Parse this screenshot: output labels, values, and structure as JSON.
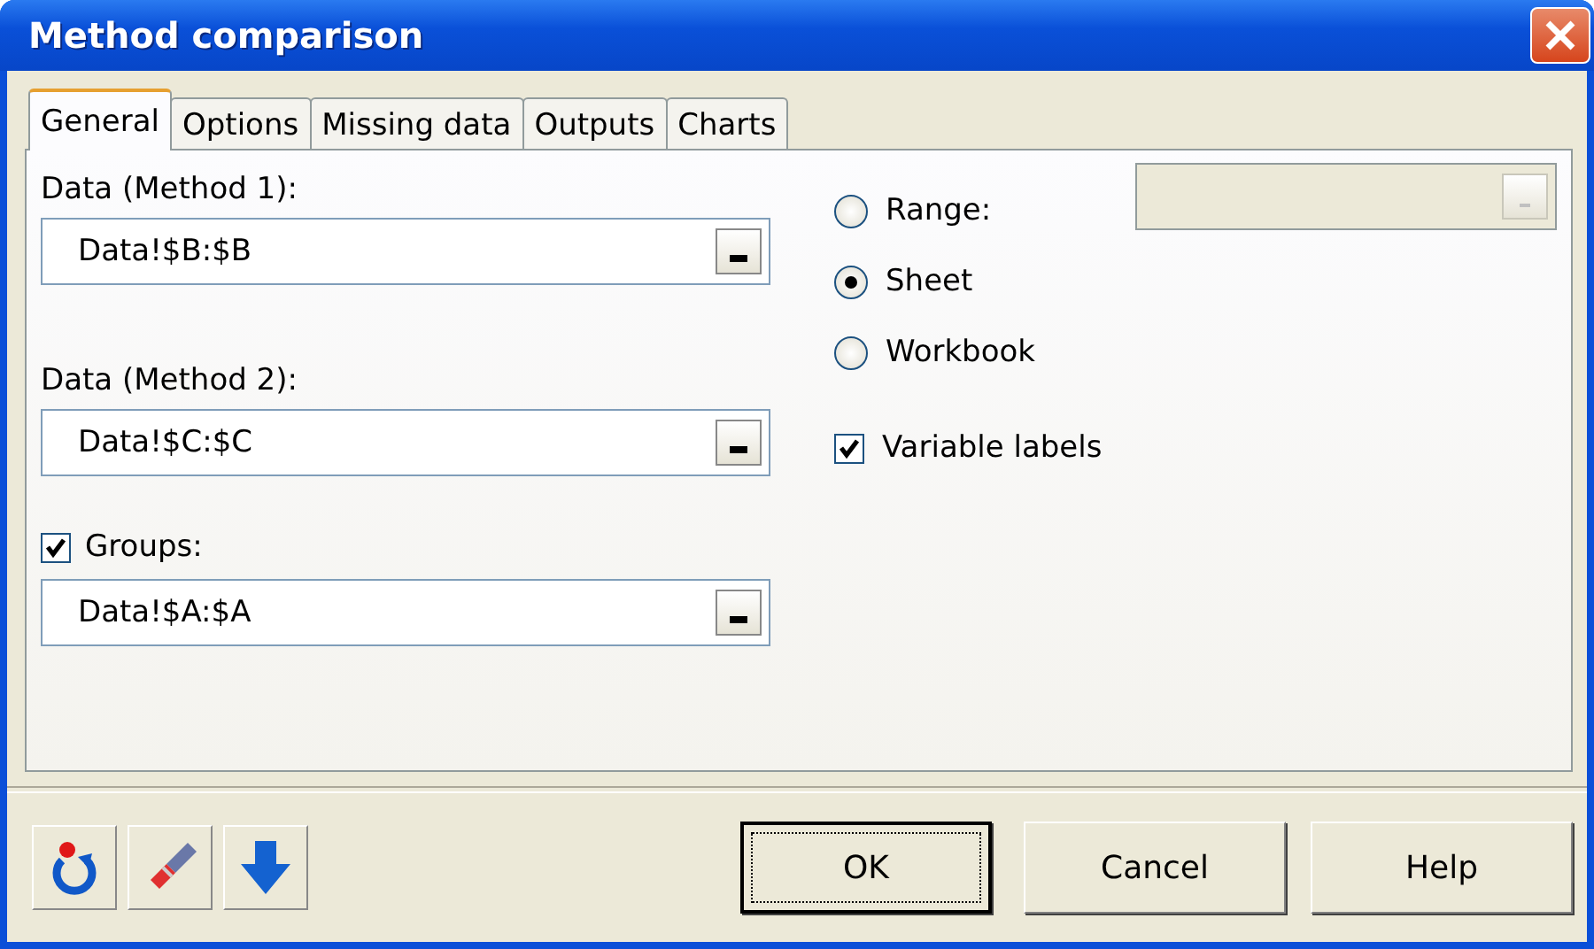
{
  "window": {
    "title": "Method comparison"
  },
  "tabs": [
    {
      "label": "General",
      "selected": true
    },
    {
      "label": "Options",
      "selected": false
    },
    {
      "label": "Missing data",
      "selected": false
    },
    {
      "label": "Outputs",
      "selected": false
    },
    {
      "label": "Charts",
      "selected": false
    }
  ],
  "data_fields": [
    {
      "label": "Data (Method 1):",
      "value": "Data!$B:$B"
    },
    {
      "label": "Data (Method 2):",
      "value": "Data!$C:$C"
    }
  ],
  "groups": {
    "label": "Groups:",
    "checked": true,
    "value": "Data!$A:$A"
  },
  "output_options": [
    {
      "label": "Range:",
      "selected": false
    },
    {
      "label": "Sheet",
      "selected": true
    },
    {
      "label": "Workbook",
      "selected": false
    }
  ],
  "range_field": {
    "disabled": true
  },
  "variable_labels": {
    "label": "Variable labels",
    "checked": true
  },
  "buttons": [
    {
      "label": "OK",
      "default": true
    },
    {
      "label": "Cancel",
      "default": false
    },
    {
      "label": "Help",
      "default": false
    }
  ]
}
